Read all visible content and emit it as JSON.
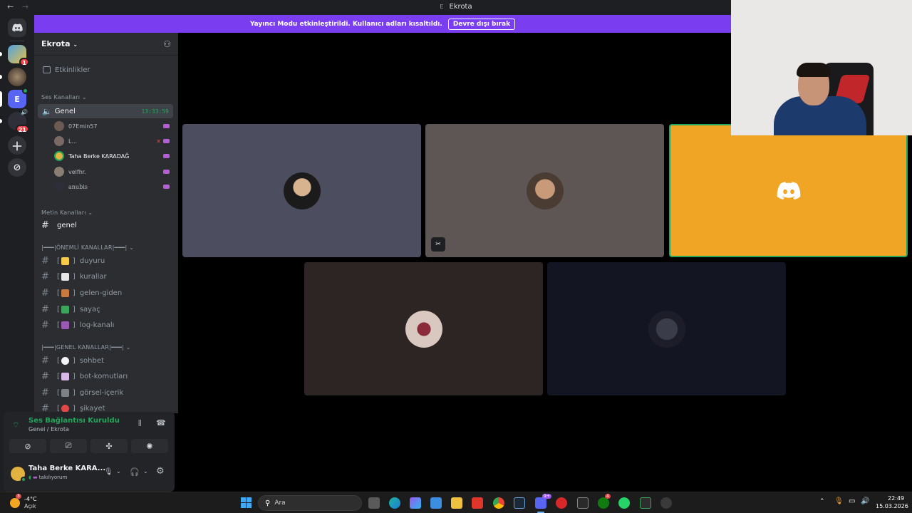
{
  "window": {
    "title": "Ekrota",
    "title_prefix": "E",
    "back": "←",
    "forward": "→"
  },
  "banner": {
    "text": "Yayıncı Modu etkinleştirildi. Kullanıcı adları kısaltıldı.",
    "button": "Devre dışı bırak"
  },
  "guilds": {
    "badges": [
      "1",
      "21"
    ],
    "selected_letter": "E",
    "speaker": "🔊"
  },
  "server": {
    "name": "Ekrota",
    "events": "Etkinlikler",
    "voice_category": "Ses Kanalları",
    "voice_channel": {
      "name": "Genel",
      "timer": "13:33:59"
    },
    "members": [
      "07Emin57",
      "L...",
      "Taha Berke KARADAĞ",
      "velfhr.",
      "anubis"
    ],
    "text_category": "Metin Kanalları",
    "text_channel": "genel",
    "important_category": "|━━━|ÖNEMLİ KANALLAR|━━━|",
    "important_channels": [
      "duyuru",
      "kurallar",
      "gelen-giden",
      "sayaç",
      "log-kanalı"
    ],
    "general_category": "|━━━|GENEL KANALLAR|━━━|",
    "general_channels": [
      "sohbet",
      "bot-komutları",
      "görsel-içerik",
      "şikayet"
    ],
    "bracket_open": "[",
    "bracket_close": "]"
  },
  "voice_panel": {
    "status": "Ses Bağlantısı Kuruldu",
    "sub": "Genel / Ekrota",
    "user_name": "Taha Berke KARA...",
    "user_status": "takılıyorum"
  },
  "taskbar": {
    "weather_temp": "-4°C",
    "weather_desc": "Açık",
    "weather_badge": "3",
    "search": "Ara",
    "time": "22:49",
    "date": "15.03.2026",
    "discord_badge": "9+",
    "xbox_badge": "4"
  },
  "colors": {
    "accent": "#7a3ef0",
    "active_tile": "#f0a525",
    "speaking": "#23a55a"
  }
}
